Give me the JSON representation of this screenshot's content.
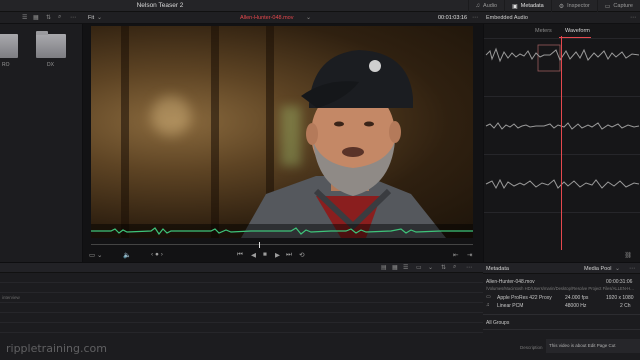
{
  "header": {
    "project_title": "Nelson Teaser 2",
    "tools": [
      {
        "label": "Audio",
        "icon": "music-note-icon"
      },
      {
        "label": "Metadata",
        "icon": "metadata-icon"
      },
      {
        "label": "Inspector",
        "icon": "inspector-icon"
      },
      {
        "label": "Capture",
        "icon": "capture-icon"
      }
    ]
  },
  "viewer": {
    "zoom": "Fit",
    "clip_name": "Allen-Hunter-048.mov",
    "timecode": "00:01:03:16"
  },
  "media_pool": {
    "folders": [
      "RO",
      "DX"
    ]
  },
  "audio_panel": {
    "title": "Embedded Audio",
    "tabs": [
      "Meters",
      "Waveform"
    ],
    "active_tab": "Waveform"
  },
  "timeline": {
    "rows": [
      "interview"
    ]
  },
  "metadata": {
    "title": "Metadata",
    "pool_label": "Media Pool",
    "clip_name": "Allen-Hunter-048.mov",
    "duration": "00:00:31:06",
    "path": "/Volumes/Macintosh HD/Users/marin/Desktop/Resolve Project Files/ALLEN-H...",
    "video_codec": "Apple ProRes 422 Proxy",
    "fps": "24.000 fps",
    "resolution": "1920 x 1080",
    "audio_codec": "Linear PCM",
    "sample_rate": "48000 Hz",
    "channels": "2 Ch",
    "groups_label": "All Groups",
    "description_label": "Description",
    "description_value": "This video is about Edit Page Cut"
  },
  "watermark": "rippletraining.com",
  "colors": {
    "accent_red": "#e5484d",
    "waveform_green": "#3ec47a",
    "waveform_gray": "#9a9a9a"
  }
}
